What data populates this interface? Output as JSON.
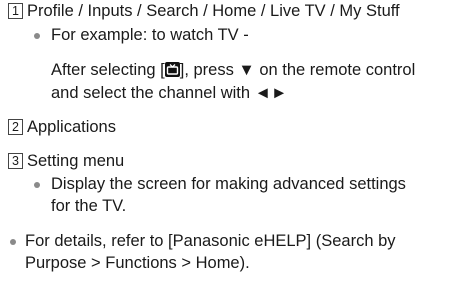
{
  "section1": {
    "number": "1",
    "title": "Profile / Inputs / Search / Home / Live TV / My Stuff",
    "example": "For example: to watch TV -",
    "step_prefix": "After selecting [",
    "step_middle": "], press ▼ on the remote control",
    "step_line2": "and select the channel with ◄►"
  },
  "section2": {
    "number": "2",
    "title": "Applications"
  },
  "section3": {
    "number": "3",
    "title": "Setting menu",
    "bullet_line1": "Display the screen for making advanced settings",
    "bullet_line2": "for the TV."
  },
  "note": {
    "line1": "For details, refer to [Panasonic eHELP] (Search by",
    "line2": "Purpose > Functions > Home)."
  },
  "icons": {
    "tv_input_icon": "tv-icon",
    "bullet_color": "#8a8a8a"
  }
}
